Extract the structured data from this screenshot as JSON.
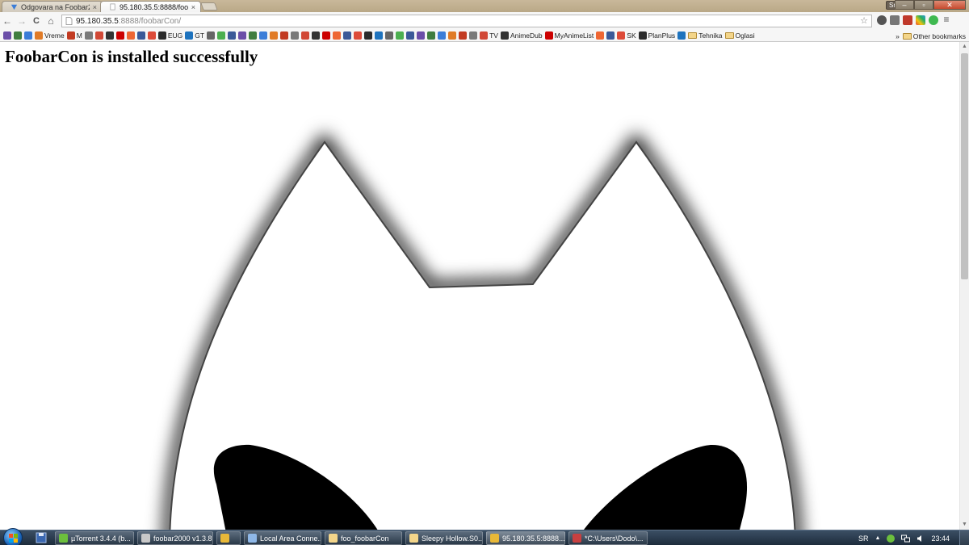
{
  "browser": {
    "tabs": [
      {
        "title": "Odgovara na Foobar2",
        "close": "×",
        "active": false
      },
      {
        "title": "95.180.35.5:8888/foob",
        "close": "×",
        "active": true
      }
    ],
    "user": "Srba",
    "window_buttons": {
      "minimize": "–",
      "maximize": "▫",
      "close": "✕"
    },
    "nav": {
      "back": "←",
      "forward": "→",
      "reload": "C",
      "home": "⌂"
    },
    "address": {
      "host": "95.180.35.5",
      "path": ":8888/foobarCon/",
      "star": "☆"
    },
    "bookmarks": {
      "items": [
        "",
        "",
        "",
        "Vreme",
        "M",
        "",
        "",
        "",
        "",
        "",
        "",
        "",
        "EUG",
        "GT",
        "",
        "",
        "",
        "",
        "",
        "",
        "",
        "",
        "",
        "",
        "",
        "",
        "",
        "",
        "",
        "",
        "",
        "",
        "",
        "",
        "",
        "",
        "",
        "",
        "",
        "",
        "TV",
        "AnimeDub",
        "MyAnimeList",
        "",
        "",
        "SK",
        "PlanPlus",
        "",
        "Tehnika",
        "Oglasi"
      ],
      "more": "»",
      "other": "Other bookmarks"
    }
  },
  "page": {
    "heading": "FoobarCon is installed successfully"
  },
  "scrollbar": {
    "up": "▲",
    "down": "▼"
  },
  "taskbar": {
    "items": [
      {
        "label": "µTorrent 3.4.4  (b...",
        "color": "#6cbf3d"
      },
      {
        "label": "foobar2000 v1.3.8",
        "color": "#c8c8c8"
      },
      {
        "label": "",
        "color": "#e8b838"
      },
      {
        "label": "Local Area Conne...",
        "color": "#8fb8e8"
      },
      {
        "label": "foo_foobarCon",
        "color": "#f3d58a"
      },
      {
        "label": "Sleepy Hollow.S0...",
        "color": "#f3d58a"
      },
      {
        "label": "95.180.35.5:8888...",
        "color": "#e8b838"
      },
      {
        "label": "*C:\\Users\\Dodo\\...",
        "color": "#c84040"
      }
    ],
    "tray": {
      "lang": "SR",
      "arrow": "▲",
      "time": "23:44"
    }
  },
  "colors": {
    "accent": "#1a64b8"
  }
}
